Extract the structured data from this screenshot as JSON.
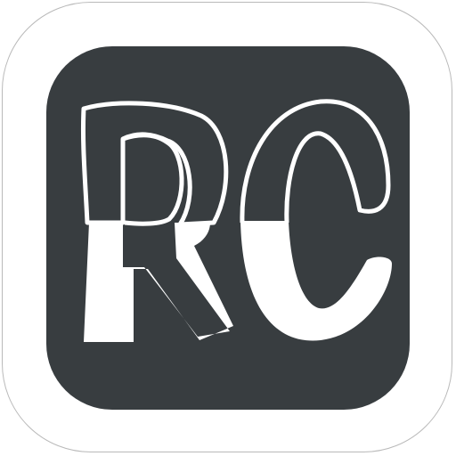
{
  "app_icon": {
    "logo_text": "RC",
    "colors": {
      "page_background": "#ffffff",
      "outer_border": "#b9b9b9",
      "tile_background": "#383d40",
      "letter_fill": "#ffffff",
      "letter_outline": "#ffffff"
    }
  }
}
